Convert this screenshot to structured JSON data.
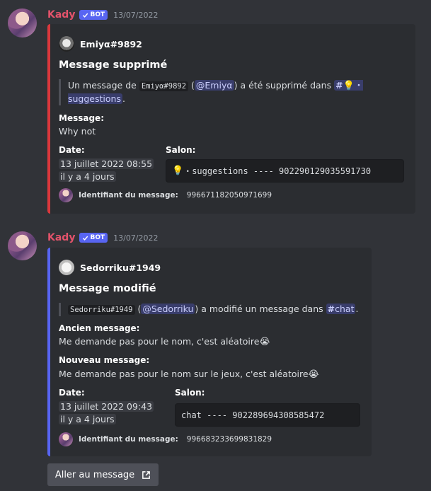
{
  "messages": [
    {
      "author": "Kady",
      "bot_badge": "BOT",
      "timestamp": "13/07/2022",
      "embed": {
        "author_name": "Emiyα#9892",
        "title": "Message supprimé",
        "desc_pre": "Un message de",
        "desc_code": "Emiyα#9892",
        "desc_mention": "@Emiyα",
        "desc_mid": "a été supprimé dans",
        "desc_channel": "suggestions",
        "desc_end": ".",
        "field_message_name": "Message:",
        "field_message_value": "Why not",
        "field_date_name": "Date:",
        "field_date_line1": "13 juillet 2022 08:55",
        "field_date_line2": "il y a 4 jours",
        "field_salon_name": "Salon:",
        "field_salon_code": "suggestions ---- 902290129035591730",
        "footer_label": "Identifiant du message:",
        "footer_value": "996671182050971699"
      }
    },
    {
      "author": "Kady",
      "bot_badge": "BOT",
      "timestamp": "13/07/2022",
      "embed": {
        "author_name": "Sedorriku#1949",
        "title": "Message modifié",
        "desc_code": "Sedorriku#1949",
        "desc_mention": "@Sedorriku",
        "desc_mid": "a modifié un message dans",
        "desc_channel": "chat",
        "desc_end": ".",
        "field_old_name": "Ancien message:",
        "field_old_value": "Me demande pas pour le nom, c'est aléatoire",
        "field_new_name": "Nouveau message:",
        "field_new_value": "Me demande pas pour le nom sur le jeux, c'est aléatoire",
        "field_date_name": "Date:",
        "field_date_line1": "13 juillet 2022 09:43",
        "field_date_line2": "il y a 4 jours",
        "field_salon_name": "Salon:",
        "field_salon_code": "chat ---- 902289694308585472",
        "footer_label": "Identifiant du message:",
        "footer_value": "996683233699831829"
      },
      "button_label": "Aller au message"
    }
  ],
  "icons": {
    "bot_check": "check-icon",
    "channel": "hash-icon",
    "external": "external-link-icon",
    "bulb": "lightbulb-emoji",
    "cry": "crying-emoji"
  },
  "colors": {
    "author": "#e4536b",
    "bot_badge": "#5865f2",
    "deleted_bar": "#da373c",
    "edited_bar": "#5865f2"
  }
}
